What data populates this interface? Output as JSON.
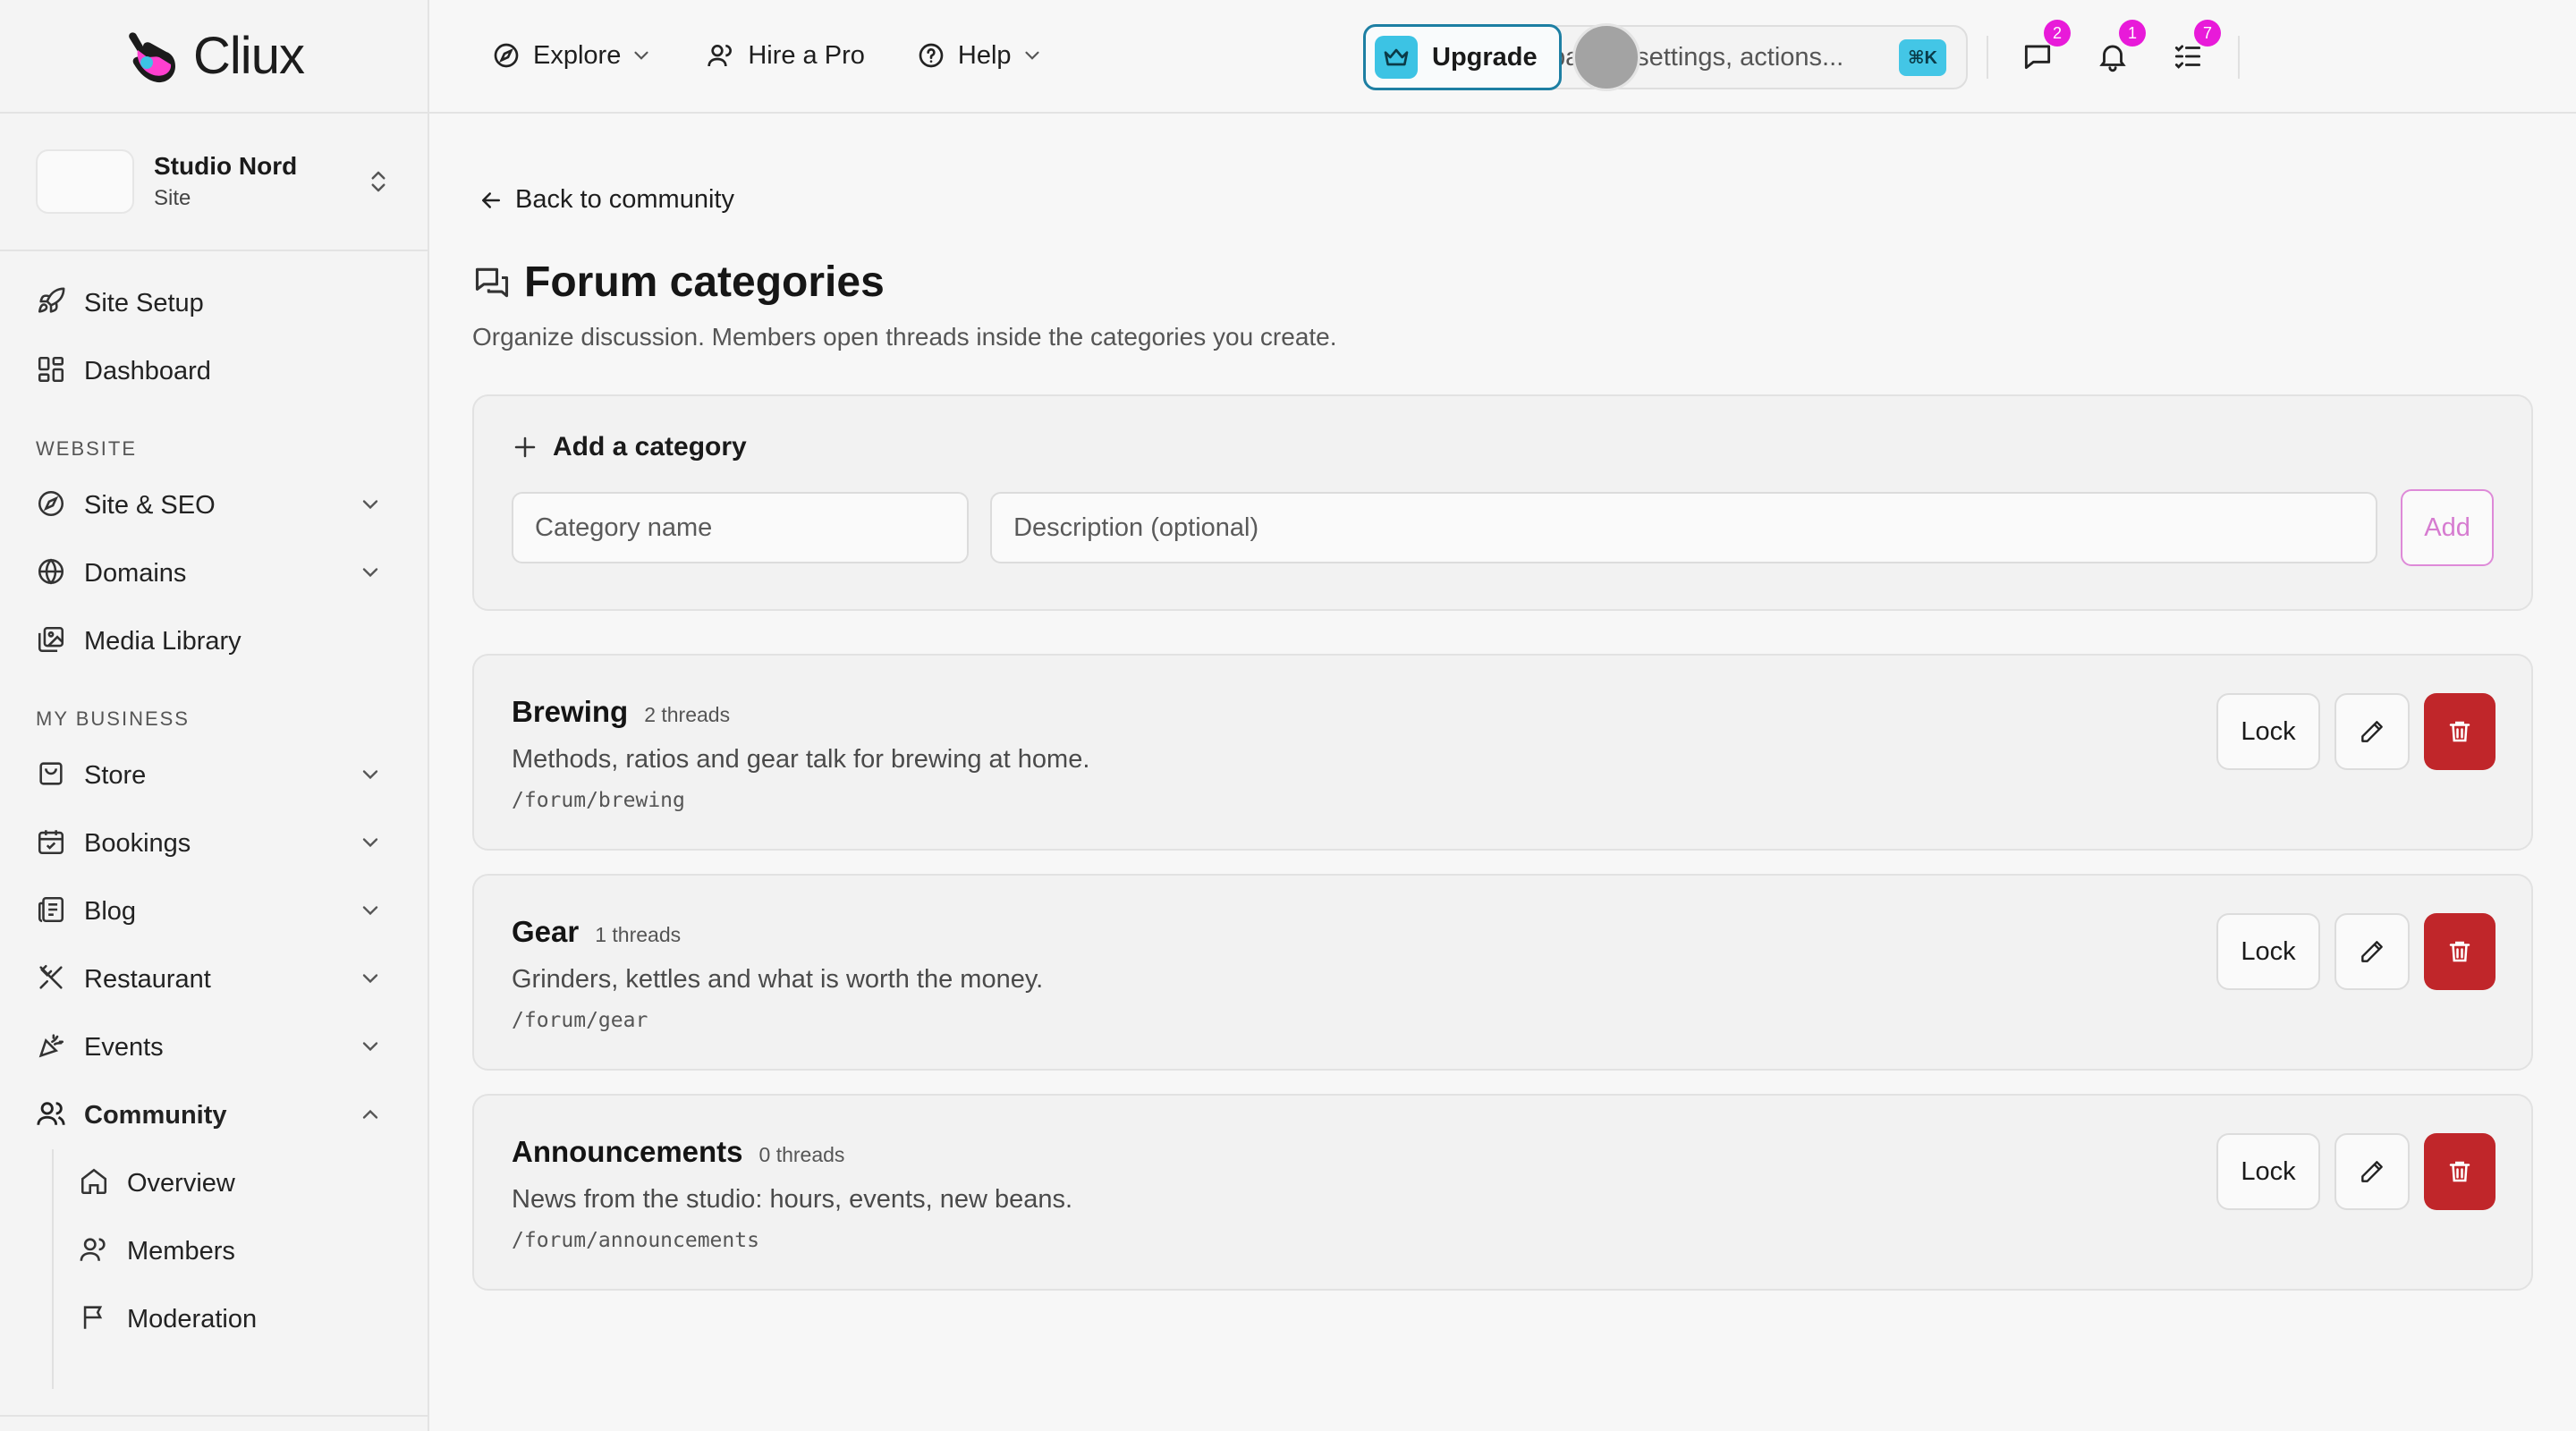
{
  "brand": {
    "name": "Cliux"
  },
  "site": {
    "name": "Studio Nord",
    "type": "Site"
  },
  "sidebar": {
    "top_items": [
      {
        "label": "Site Setup",
        "icon": "rocket-icon"
      },
      {
        "label": "Dashboard",
        "icon": "dashboard-icon"
      }
    ],
    "sections": {
      "website": "WEBSITE",
      "my_business": "MY BUSINESS"
    },
    "website_items": [
      {
        "label": "Site & SEO",
        "icon": "compass-icon"
      },
      {
        "label": "Domains",
        "icon": "globe-icon"
      },
      {
        "label": "Media Library",
        "icon": "media-icon"
      }
    ],
    "business_items": [
      {
        "label": "Store",
        "icon": "shopping-bag-icon"
      },
      {
        "label": "Bookings",
        "icon": "calendar-icon"
      },
      {
        "label": "Blog",
        "icon": "newspaper-icon"
      },
      {
        "label": "Restaurant",
        "icon": "utensils-icon"
      },
      {
        "label": "Events",
        "icon": "party-icon"
      },
      {
        "label": "Community",
        "icon": "users-icon"
      }
    ],
    "community_sub": [
      {
        "label": "Overview",
        "icon": "home-icon"
      },
      {
        "label": "Members",
        "icon": "user-icon"
      },
      {
        "label": "Moderation",
        "icon": "flag-icon"
      }
    ]
  },
  "topbar": {
    "explore": "Explore",
    "hire": "Hire a Pro",
    "help": "Help",
    "search_placeholder": "Search pages, settings, actions...",
    "shortcut": "⌘K",
    "messages_badge": "2",
    "notifications_badge": "1",
    "tasks_badge": "7",
    "upgrade": "Upgrade"
  },
  "colors": {
    "accent": "#43c6e6",
    "badge": "#e81ad9",
    "danger": "#c0262a",
    "add_button": "#d67bd0"
  },
  "main": {
    "back_link": "Back to community",
    "title": "Forum categories",
    "description": "Organize discussion. Members open threads inside the categories you create.",
    "add": {
      "heading": "Add a category",
      "name_placeholder": "Category name",
      "desc_placeholder": "Description (optional)",
      "button": "Add"
    },
    "lock_label": "Lock",
    "categories": [
      {
        "name": "Brewing",
        "count": "2 threads",
        "description": "Methods, ratios and gear talk for brewing at home.",
        "slug": "/forum/brewing"
      },
      {
        "name": "Gear",
        "count": "1 threads",
        "description": "Grinders, kettles and what is worth the money.",
        "slug": "/forum/gear"
      },
      {
        "name": "Announcements",
        "count": "0 threads",
        "description": "News from the studio: hours, events, new beans.",
        "slug": "/forum/announcements"
      }
    ]
  }
}
